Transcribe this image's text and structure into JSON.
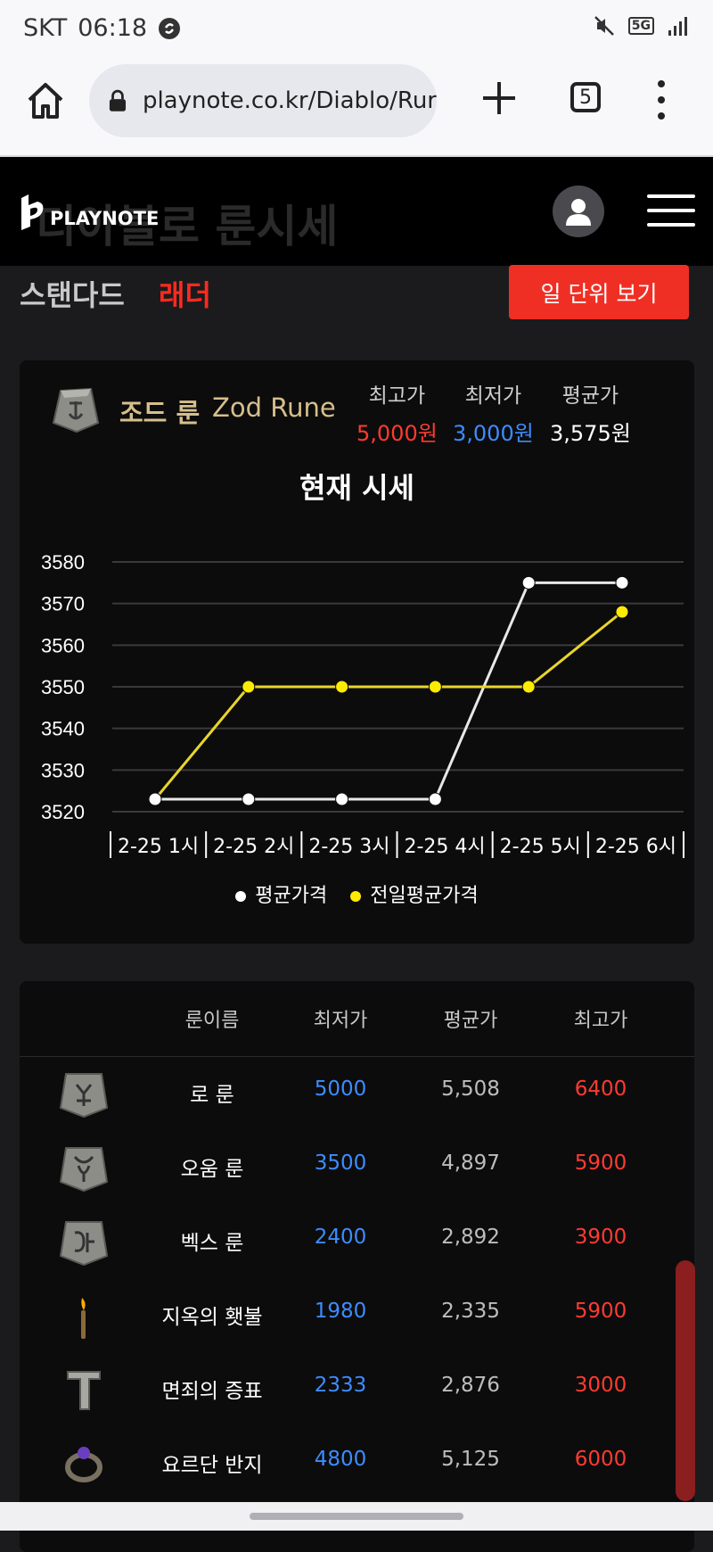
{
  "status_bar": {
    "carrier": "SKT",
    "time": "06:18",
    "network": "5G"
  },
  "browser": {
    "url": "playnote.co.kr/Diablo/Rur",
    "tab_count": "5"
  },
  "site": {
    "logo_text": "PLAYNOTE",
    "ghost_title": "디아블로 룬시세"
  },
  "modes": {
    "standard": "스탠다드",
    "ladder": "래더",
    "day_view_button": "일 단위 보기"
  },
  "rune": {
    "name_ko": "조드 룬",
    "name_en": "Zod Rune",
    "stats": [
      {
        "label": "최고가",
        "value": "5,000원",
        "color": "#ff3b30"
      },
      {
        "label": "최저가",
        "value": "3,000원",
        "color": "#3d8cff"
      },
      {
        "label": "평균가",
        "value": "3,575원",
        "color": "#ffffff"
      }
    ]
  },
  "chart_data": {
    "type": "line",
    "title": "현재 시세",
    "categories": [
      "2-25 1시",
      "2-25 2시",
      "2-25 3시",
      "2-25 4시",
      "2-25 5시",
      "2-25 6시"
    ],
    "series": [
      {
        "name": "평균가격",
        "color": "#e8e8e8",
        "marker": "#ffffff",
        "values": [
          3523,
          3523,
          3523,
          3523,
          3575,
          3575
        ]
      },
      {
        "name": "전일평균가격",
        "color": "#e8d52a",
        "marker": "#ffeb00",
        "values": [
          3523,
          3550,
          3550,
          3550,
          3550,
          3568
        ]
      }
    ],
    "yticks": [
      3520,
      3530,
      3540,
      3550,
      3560,
      3570,
      3580
    ],
    "ylim": [
      3520,
      3580
    ],
    "grid": true,
    "legend": "bottom"
  },
  "table": {
    "headers": [
      "룬이름",
      "최저가",
      "평균가",
      "최고가"
    ],
    "rows": [
      {
        "icon": "ber-rune-icon",
        "name": "로 룬",
        "min": "5000",
        "avg": "5,508",
        "max": "6400"
      },
      {
        "icon": "ohm-rune-icon",
        "name": "오움 룬",
        "min": "3500",
        "avg": "4,897",
        "max": "5900"
      },
      {
        "icon": "vex-rune-icon",
        "name": "벡스 룬",
        "min": "2400",
        "avg": "2,892",
        "max": "3900"
      },
      {
        "icon": "torch-icon",
        "name": "지옥의 횃불",
        "min": "1980",
        "avg": "2,335",
        "max": "5900"
      },
      {
        "icon": "token-icon",
        "name": "면죄의 증표",
        "min": "2333",
        "avg": "2,876",
        "max": "3000"
      },
      {
        "icon": "ring-icon",
        "name": "요르단 반지",
        "min": "4800",
        "avg": "5,125",
        "max": "6000"
      }
    ]
  }
}
